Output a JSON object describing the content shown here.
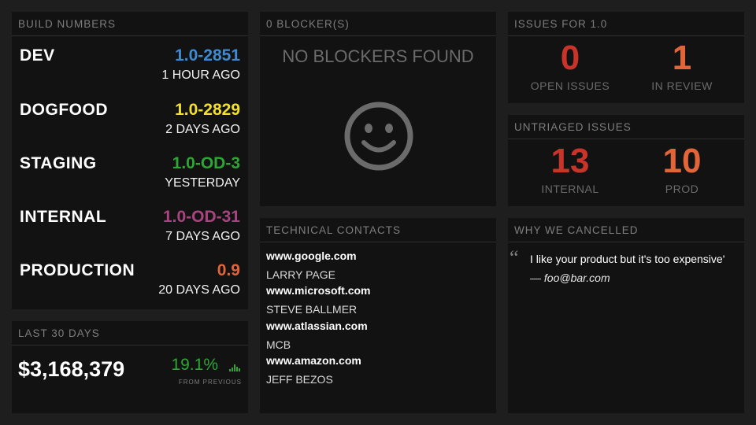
{
  "build": {
    "title": "BUILD NUMBERS",
    "rows": [
      {
        "env": "DEV",
        "version": "1.0-2851",
        "ago": "1 HOUR AGO",
        "color": "#3f8bd3"
      },
      {
        "env": "DOGFOOD",
        "version": "1.0-2829",
        "ago": "2 DAYS AGO",
        "color": "#f4e12b"
      },
      {
        "env": "STAGING",
        "version": "1.0-OD-3",
        "ago": "YESTERDAY",
        "color": "#2ea535"
      },
      {
        "env": "INTERNAL",
        "version": "1.0-OD-31",
        "ago": "7 DAYS AGO",
        "color": "#a8457f"
      },
      {
        "env": "PRODUCTION",
        "version": "0.9",
        "ago": "20 DAYS AGO",
        "color": "#e2653a"
      }
    ]
  },
  "last30": {
    "title": "LAST 30 DAYS",
    "amount": "$3,168,379",
    "percent": "19.1%",
    "caption": "FROM PREVIOUS",
    "trend_icon": "bar-trend-icon"
  },
  "blockers": {
    "title": "0 BLOCKER(S)",
    "message": "NO BLOCKERS FOUND",
    "icon": "smiley-icon"
  },
  "contacts": {
    "title": "TECHNICAL CONTACTS",
    "items": [
      {
        "site": "www.google.com",
        "name": "LARRY PAGE"
      },
      {
        "site": "www.microsoft.com",
        "name": "STEVE BALLMER"
      },
      {
        "site": "www.atlassian.com",
        "name": "MCB"
      },
      {
        "site": "www.amazon.com",
        "name": "JEFF BEZOS"
      }
    ]
  },
  "issues": {
    "title": "ISSUES FOR 1.0",
    "open": {
      "value": "0",
      "label": "OPEN ISSUES"
    },
    "review": {
      "value": "1",
      "label": "IN REVIEW"
    }
  },
  "untriaged": {
    "title": "UNTRIAGED ISSUES",
    "internal": {
      "value": "13",
      "label": "INTERNAL"
    },
    "prod": {
      "value": "10",
      "label": "PROD"
    }
  },
  "cancelled": {
    "title": "WHY WE CANCELLED",
    "quote": "I like your product but it's too expensive'",
    "author": "— foo@bar.com"
  },
  "colors": {
    "red": "#c9342a",
    "orange": "#e2653a",
    "green": "#2ea535"
  }
}
